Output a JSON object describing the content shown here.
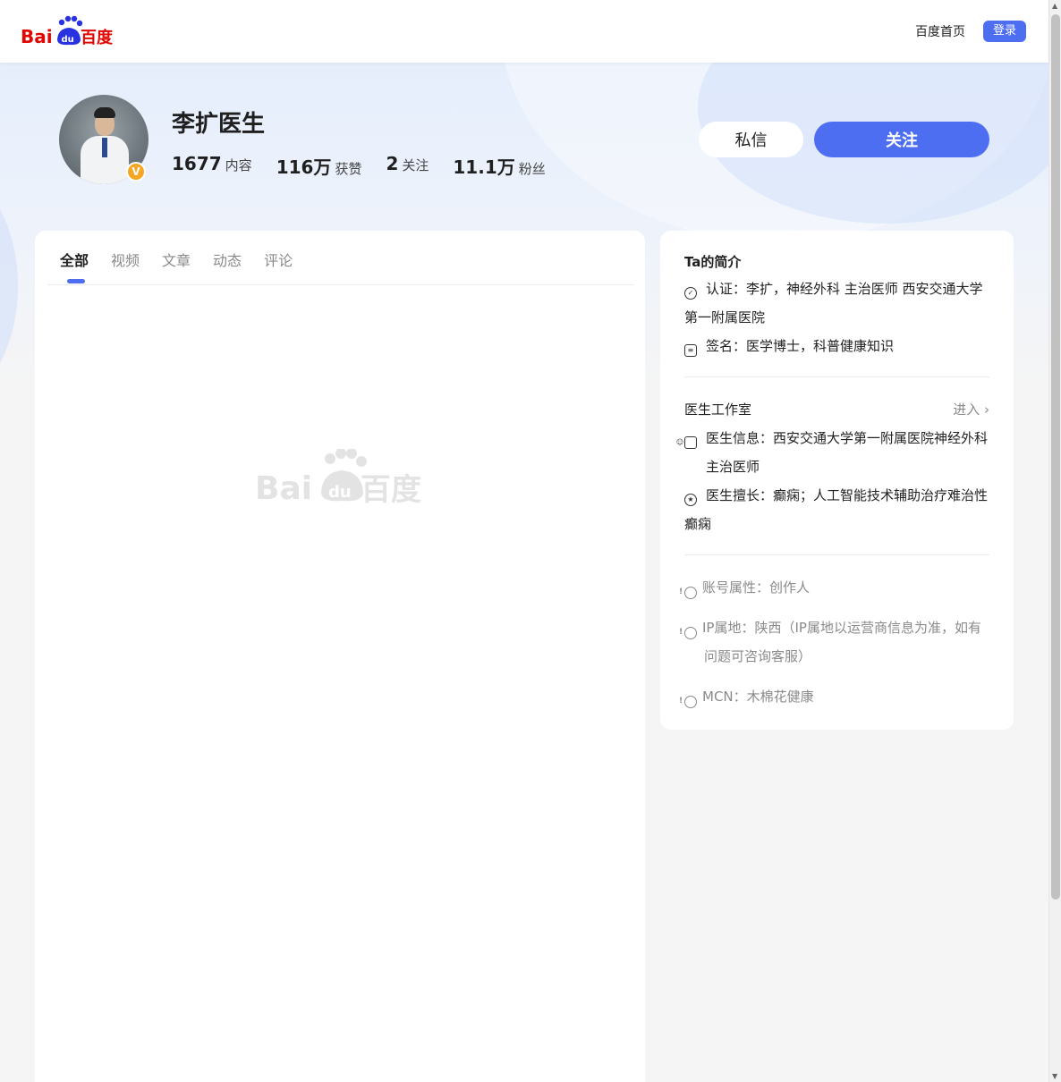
{
  "header": {
    "logo_text": "Bai百度",
    "home_link": "百度首页",
    "login_button": "登录"
  },
  "profile": {
    "name": "李扩医生",
    "verified_badge": "V",
    "stats": [
      {
        "value": "1677",
        "label": "内容"
      },
      {
        "value": "116万",
        "label": "获赞"
      },
      {
        "value": "2",
        "label": "关注"
      },
      {
        "value": "11.1万",
        "label": "粉丝"
      }
    ],
    "message_button": "私信",
    "follow_button": "关注"
  },
  "tabs": [
    {
      "label": "全部",
      "active": true
    },
    {
      "label": "视频",
      "active": false
    },
    {
      "label": "文章",
      "active": false
    },
    {
      "label": "动态",
      "active": false
    },
    {
      "label": "评论",
      "active": false
    }
  ],
  "sidebar": {
    "intro_title": "Ta的简介",
    "certification": "认证：李扩，神经外科 主治医师 西安交通大学第一附属医院",
    "signature": "签名：医学博士，科普健康知识",
    "studio_title": "医生工作室",
    "studio_enter": "进入",
    "doctor_info": "医生信息：西安交通大学第一附属医院神经外科主治医师",
    "doctor_specialty": "医生擅长：癫痫；人工智能技术辅助治疗难治性癫痫",
    "account_type": "账号属性：创作人",
    "ip_location": "IP属地：陕西（IP属地以运营商信息为准，如有问题可咨询客服）",
    "mcn": "MCN：木棉花健康"
  },
  "colors": {
    "accent": "#4e6ef2",
    "badge": "#f6a623",
    "baidu_red": "#e10601",
    "baidu_blue": "#2932e1"
  }
}
